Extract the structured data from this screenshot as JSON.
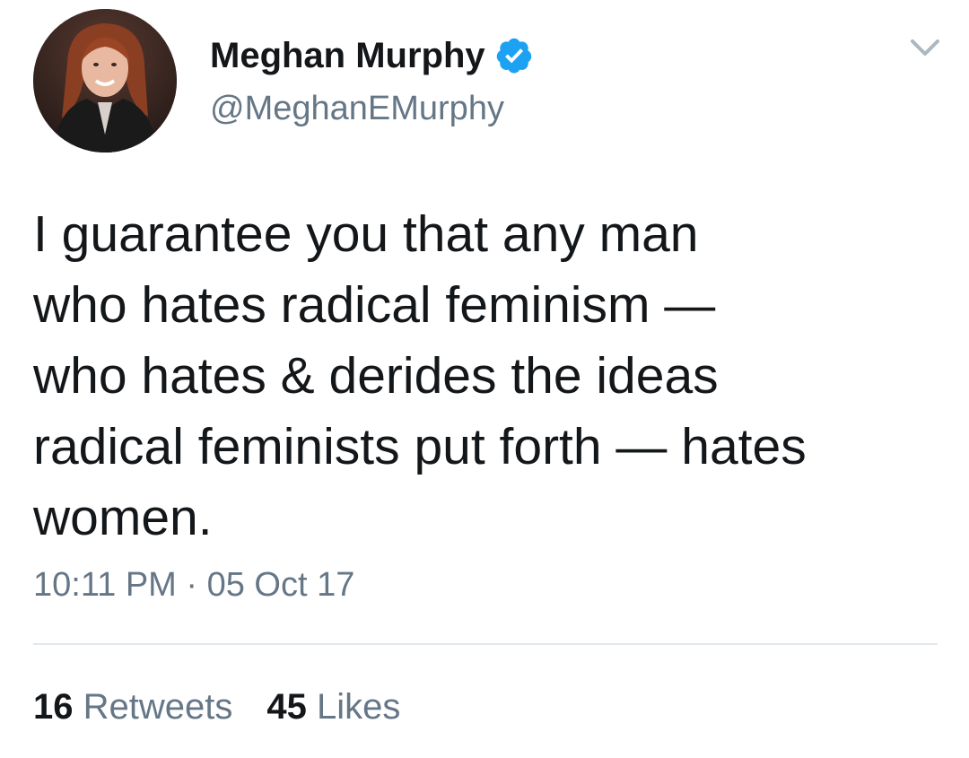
{
  "tweet": {
    "author": {
      "display_name": "Meghan Murphy",
      "handle": "@MeghanEMurphy",
      "verified": true,
      "verified_icon": "verified-badge-icon",
      "avatar": "profile-photo"
    },
    "menu_icon": "chevron-down-icon",
    "text_lines": [
      "I guarantee you that any man",
      "who hates radical feminism —",
      "who hates & derides the ideas",
      "radical feminists put forth — hates",
      "women."
    ],
    "timestamp": "10:11 PM · 05 Oct 17",
    "stats": {
      "retweets_count": "16",
      "retweets_label": "Retweets",
      "likes_count": "45",
      "likes_label": "Likes"
    }
  },
  "colors": {
    "text_primary": "#14171a",
    "text_secondary": "#657786",
    "verified_blue": "#1da1f2",
    "divider": "#e1e8ed",
    "background": "#ffffff"
  }
}
